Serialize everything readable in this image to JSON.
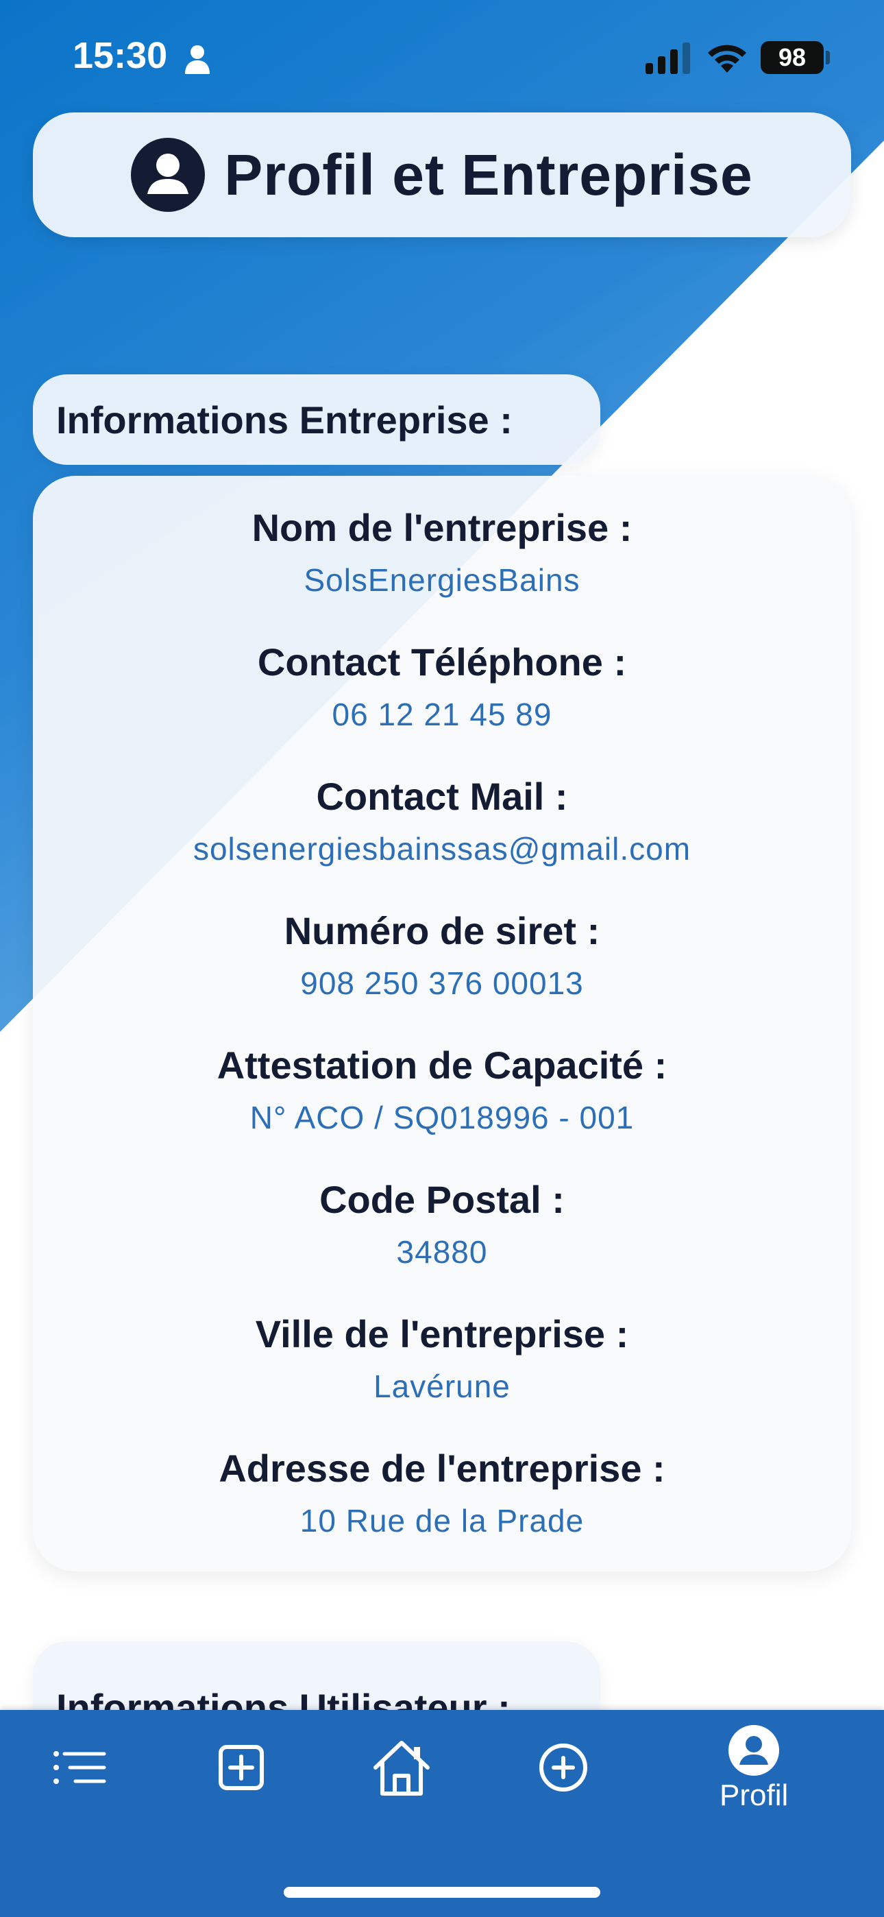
{
  "status_bar": {
    "time": "15:30",
    "battery": "98"
  },
  "header": {
    "title": "Profil et Entreprise"
  },
  "sections": {
    "company_title": "Informations Entreprise :",
    "user_title": "Informations Utilisateur :"
  },
  "company": {
    "items": [
      {
        "label": "Nom de l'entreprise :",
        "value": "SolsEnergiesBains"
      },
      {
        "label": "Contact Téléphone :",
        "value": "06 12 21 45 89"
      },
      {
        "label": "Contact Mail :",
        "value": "solsenergiesbainssas@gmail.com"
      },
      {
        "label": "Numéro de siret :",
        "value": "908 250 376 00013"
      },
      {
        "label": "Attestation de Capacité :",
        "value": "N° ACO / SQ018996 - 001"
      },
      {
        "label": "Code Postal :",
        "value": "34880"
      },
      {
        "label": "Ville de l'entreprise :",
        "value": "Lavérune"
      },
      {
        "label": "Adresse de l'entreprise :",
        "value": "10 Rue de la Prade"
      }
    ]
  },
  "nav": {
    "items": [
      {
        "icon": "list-icon"
      },
      {
        "icon": "plus-square-icon"
      },
      {
        "icon": "home-icon"
      },
      {
        "icon": "plus-circle-icon"
      },
      {
        "icon": "profile-icon",
        "label": "Profil"
      }
    ]
  },
  "colors": {
    "primary_blue": "#2069b8",
    "value_blue": "#2c6fb6",
    "dark_text": "#141c33"
  }
}
